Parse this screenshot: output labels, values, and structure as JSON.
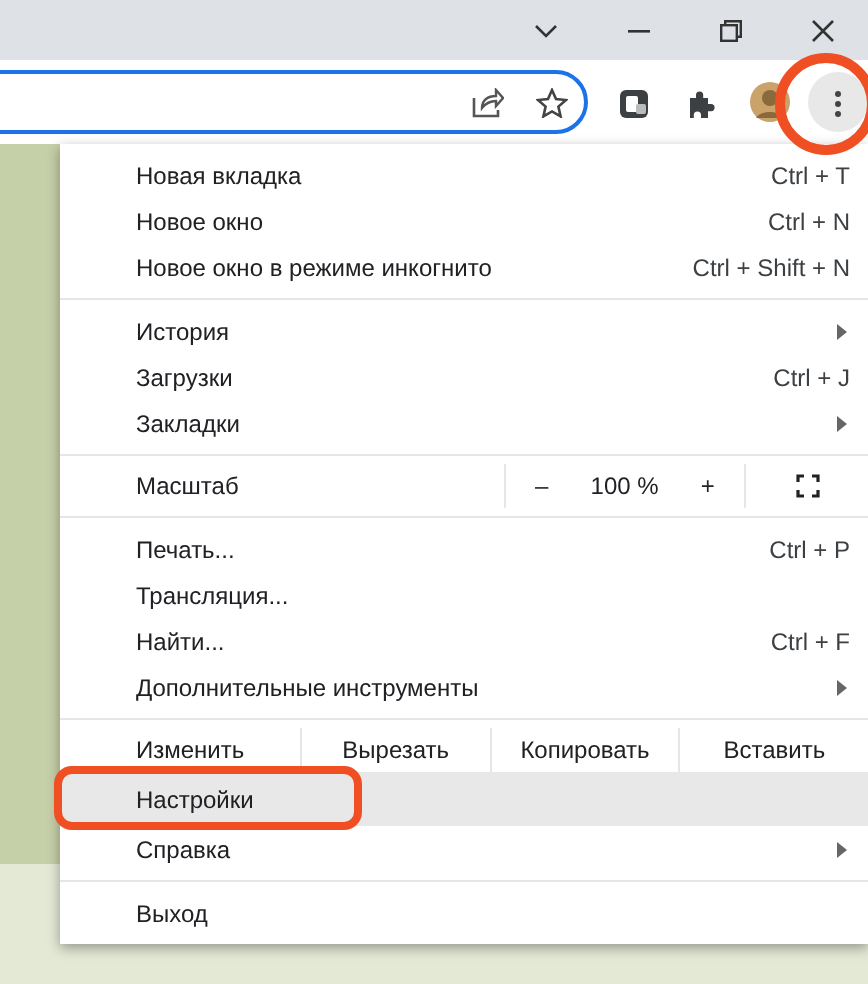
{
  "menu": {
    "items": [
      {
        "kind": "item",
        "label": "Новая вкладка",
        "shortcut": "Ctrl + T",
        "submenu": false,
        "selected": false
      },
      {
        "kind": "item",
        "label": "Новое окно",
        "shortcut": "Ctrl + N",
        "submenu": false,
        "selected": false
      },
      {
        "kind": "item",
        "label": "Новое окно в режиме инкогнито",
        "shortcut": "Ctrl + Shift + N",
        "submenu": false,
        "selected": false
      },
      {
        "kind": "separator"
      },
      {
        "kind": "item",
        "label": "История",
        "submenu": true,
        "selected": false
      },
      {
        "kind": "item",
        "label": "Загрузки",
        "shortcut": "Ctrl + J",
        "submenu": false,
        "selected": false
      },
      {
        "kind": "item",
        "label": "Закладки",
        "submenu": true,
        "selected": false
      },
      {
        "kind": "separator"
      },
      {
        "kind": "zoom",
        "label": "Масштаб",
        "minus": "–",
        "value": "100 %",
        "plus": "+"
      },
      {
        "kind": "separator"
      },
      {
        "kind": "item",
        "label": "Печать...",
        "shortcut": "Ctrl + P",
        "submenu": false,
        "selected": false
      },
      {
        "kind": "item",
        "label": "Трансляция...",
        "submenu": false,
        "selected": false
      },
      {
        "kind": "item",
        "label": "Найти...",
        "shortcut": "Ctrl + F",
        "submenu": false,
        "selected": false
      },
      {
        "kind": "item",
        "label": "Дополнительные инструменты",
        "submenu": true,
        "selected": false
      },
      {
        "kind": "separator"
      },
      {
        "kind": "edit",
        "label": "Изменить",
        "buttons": [
          "Вырезать",
          "Копировать",
          "Вставить"
        ]
      },
      {
        "kind": "item",
        "label": "Настройки",
        "submenu": false,
        "selected": true
      },
      {
        "kind": "item",
        "label": "Справка",
        "submenu": true,
        "selected": false
      },
      {
        "kind": "separator"
      },
      {
        "kind": "item",
        "label": "Выход",
        "submenu": false,
        "selected": false
      }
    ]
  }
}
